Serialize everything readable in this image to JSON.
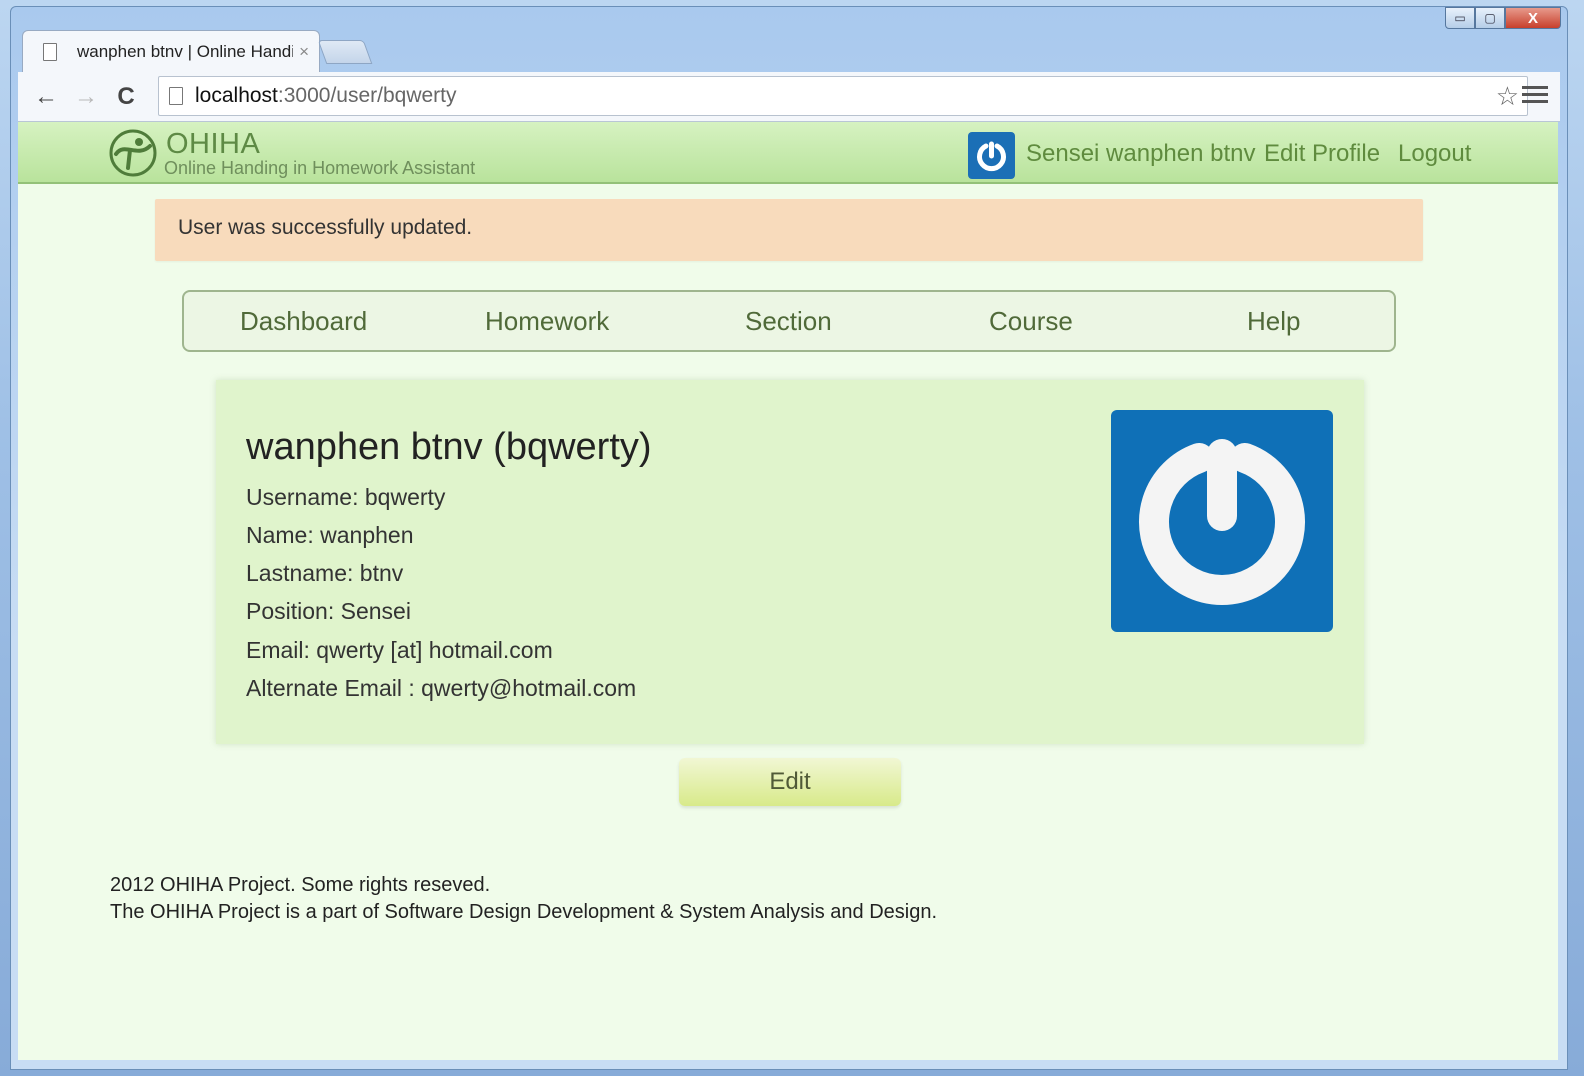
{
  "browser": {
    "tab_title": "wanphen btnv | Online Handing in Homework Assistant",
    "tab_close": "×",
    "url_host": "localhost",
    "url_path": ":3000/user/bqwerty",
    "back_icon": "←",
    "forward_icon": "→",
    "reload_icon": "C",
    "star_icon": "☆",
    "window_controls": {
      "minimize": "▭",
      "maximize": "▢",
      "close": "X"
    }
  },
  "header": {
    "logo_title": "OHIHA",
    "logo_subtitle": "Online Handing in Homework Assistant",
    "user_link": "Sensei wanphen btnv",
    "edit_profile": "Edit Profile",
    "logout": "Logout"
  },
  "flash": {
    "message": "User was successfully updated."
  },
  "nav": {
    "items": [
      {
        "label": "Dashboard"
      },
      {
        "label": "Homework"
      },
      {
        "label": "Section"
      },
      {
        "label": "Course"
      },
      {
        "label": "Help"
      }
    ]
  },
  "profile": {
    "heading": "wanphen btnv (bqwerty)",
    "rows": [
      "Username: bqwerty",
      "Name: wanphen",
      "Lastname: btnv",
      "Position: Sensei",
      "Email: qwerty [at] hotmail.com",
      "Alternate Email : qwerty@hotmail.com"
    ],
    "edit_label": "Edit"
  },
  "footer": {
    "line1": "2012 OHIHA Project. Some rights reseved.",
    "line2": "The OHIHA Project is a part of Software Design Development & System Analysis and Design."
  },
  "colors": {
    "header_green": "#b9e39c",
    "page_bg": "#f0fcea",
    "flash_bg": "#f8dbbc",
    "avatar_blue": "#0f70b7",
    "link_green": "#5f8b3e"
  }
}
